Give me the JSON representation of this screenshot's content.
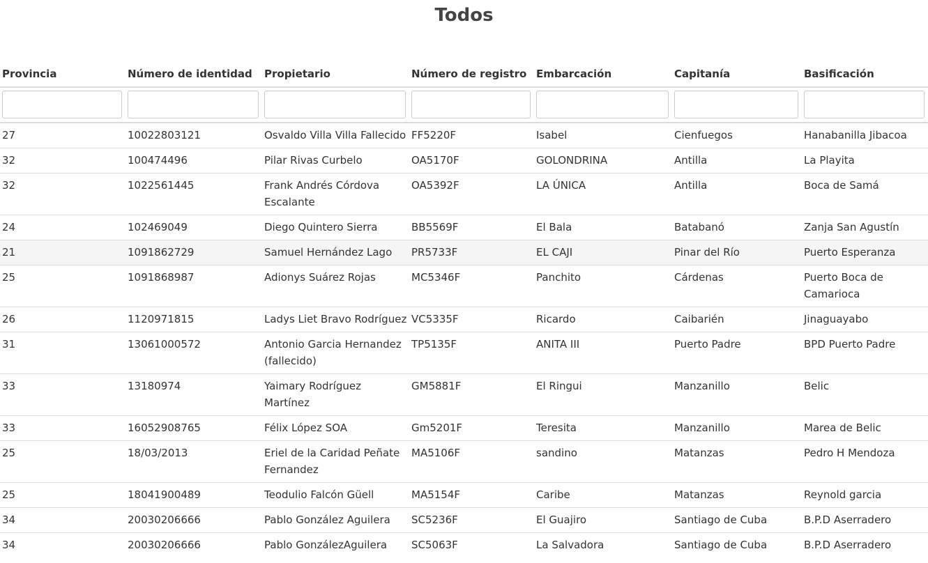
{
  "page": {
    "title": "Todos"
  },
  "table": {
    "columns": [
      "Provincia",
      "Número de identidad",
      "Propietario",
      "Número de registro",
      "Embarcación",
      "Capitanía",
      "Basificación"
    ],
    "filters": [
      "",
      "",
      "",
      "",
      "",
      "",
      ""
    ],
    "rows": [
      [
        "27",
        "10022803121",
        "Osvaldo Villa Villa Fallecido",
        "FF5220F",
        "Isabel",
        "Cienfuegos",
        "Hanabanilla Jibacoa"
      ],
      [
        "32",
        "100474496",
        "Pilar Rivas Curbelo",
        "OA5170F",
        "GOLONDRINA",
        "Antilla",
        "La Playita"
      ],
      [
        "32",
        "1022561445",
        "Frank Andrés Córdova Escalante",
        "OA5392F",
        "LA ÚNICA",
        "Antilla",
        "Boca de Samá"
      ],
      [
        "24",
        "102469049",
        "Diego Quintero Sierra",
        "BB5569F",
        "El Bala",
        "Batabanó",
        "Zanja San Agustín"
      ],
      [
        "21",
        "1091862729",
        "Samuel Hernández Lago",
        "PR5733F",
        "EL CAJI",
        "Pinar del Río",
        "Puerto Esperanza"
      ],
      [
        "25",
        "1091868987",
        "Adionys Suárez Rojas",
        "MC5346F",
        "Panchito",
        "Cárdenas",
        "Puerto Boca de Camarioca"
      ],
      [
        "26",
        "1120971815",
        "Ladys Liet Bravo Rodríguez",
        "VC5335F",
        "Ricardo",
        "Caibarién",
        "Jinaguayabo"
      ],
      [
        "31",
        "13061000572",
        "Antonio Garcia Hernandez (fallecido)",
        "TP5135F",
        "ANITA III",
        "Puerto Padre",
        "BPD Puerto Padre"
      ],
      [
        "33",
        "13180974",
        "Yaimary Rodríguez Martínez",
        "GM5881F",
        "El Ringui",
        "Manzanillo",
        "Belic"
      ],
      [
        "33",
        "16052908765",
        "Félix López SOA",
        "Gm5201F",
        "Teresita",
        "Manzanillo",
        "Marea de Belic"
      ],
      [
        "25",
        "18/03/2013",
        "Eriel de la Caridad Peñate Fernandez",
        "MA5106F",
        "sandino",
        "Matanzas",
        "Pedro H Mendoza"
      ],
      [
        "25",
        "18041900489",
        "Teodulio Falcón Güell",
        "MA5154F",
        "Caribe",
        "Matanzas",
        "Reynold garcia"
      ],
      [
        "34",
        "20030206666",
        "Pablo González Aguilera",
        "SC5236F",
        "El Guajiro",
        "Santiago de Cuba",
        "B.P.D Aserradero"
      ],
      [
        "34",
        "20030206666",
        "Pablo GonzálezAguilera",
        "SC5063F",
        "La Salvadora",
        "Santiago de Cuba",
        "B.P.D Aserradero"
      ]
    ],
    "highlighted_row": 4
  }
}
